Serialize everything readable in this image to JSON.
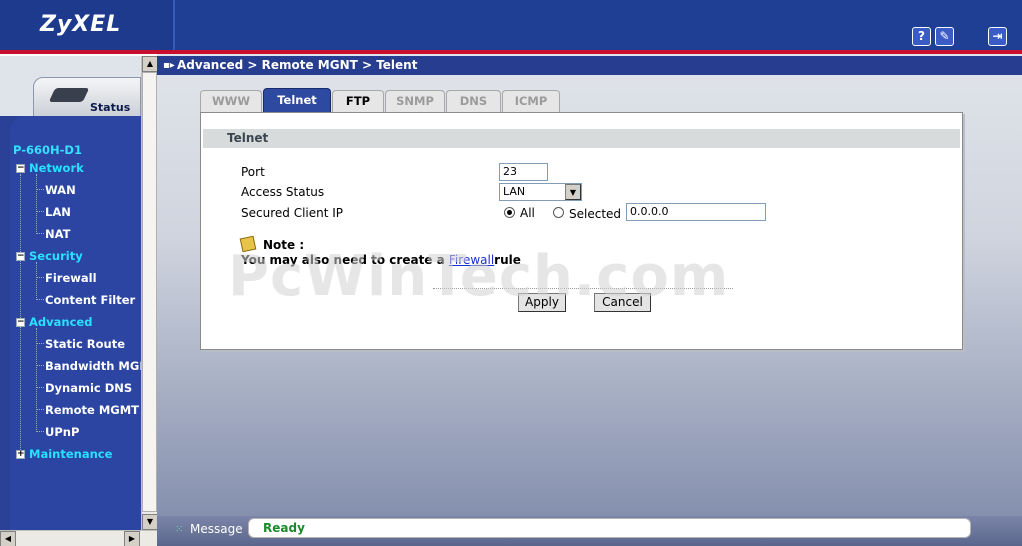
{
  "brand": {
    "logo_text": "ZyXEL"
  },
  "header_icons": [
    {
      "name": "help-icon",
      "glyph": "?"
    },
    {
      "name": "wizard-icon",
      "glyph": "✎"
    },
    {
      "name": "logout-icon",
      "glyph": "⇥"
    }
  ],
  "sidebar": {
    "status_label": "Status",
    "model": "P-660H-D1",
    "menu": [
      {
        "label": "Network",
        "type": "category",
        "expanded": true
      },
      {
        "label": "WAN",
        "type": "sub"
      },
      {
        "label": "LAN",
        "type": "sub"
      },
      {
        "label": "NAT",
        "type": "sub"
      },
      {
        "label": "Security",
        "type": "category",
        "expanded": true
      },
      {
        "label": "Firewall",
        "type": "sub"
      },
      {
        "label": "Content Filter",
        "type": "sub"
      },
      {
        "label": "Advanced",
        "type": "category",
        "expanded": true
      },
      {
        "label": "Static Route",
        "type": "sub"
      },
      {
        "label": "Bandwidth MGMT",
        "type": "sub"
      },
      {
        "label": "Dynamic DNS",
        "type": "sub"
      },
      {
        "label": "Remote MGMT",
        "type": "sub"
      },
      {
        "label": "UPnP",
        "type": "sub"
      },
      {
        "label": "Maintenance",
        "type": "category",
        "expanded": false
      }
    ]
  },
  "breadcrumb": "Advanced > Remote MGNT > Telent",
  "tabs": [
    {
      "label": "WWW",
      "state": "disabled"
    },
    {
      "label": "Telnet",
      "state": "active"
    },
    {
      "label": "FTP",
      "state": "enabled"
    },
    {
      "label": "SNMP",
      "state": "disabled"
    },
    {
      "label": "DNS",
      "state": "disabled"
    },
    {
      "label": "ICMP",
      "state": "disabled"
    }
  ],
  "form": {
    "section_title": "Telnet",
    "port_label": "Port",
    "port_value": "23",
    "access_status_label": "Access Status",
    "access_status_value": "LAN",
    "secured_ip_label": "Secured Client IP",
    "radio_all_label": "All",
    "radio_selected_label": "Selected",
    "radio_selected_value": "All",
    "selected_ip_value": "0.0.0.0",
    "note_label": "Note :",
    "note_text_before": "You may also need to create a ",
    "note_link": "Firewall",
    "note_text_after": "rule",
    "apply_label": "Apply",
    "cancel_label": "Cancel"
  },
  "watermark": "PcWinTech.com",
  "statusbar": {
    "message_label": "Message",
    "message_text": "Ready"
  },
  "colors": {
    "header_blue": "#1f3f94",
    "header_red": "#c8102e",
    "menu_category": "#27e1ff",
    "status_ok": "#1a8a2a",
    "active_tab": "#2e49a0"
  }
}
